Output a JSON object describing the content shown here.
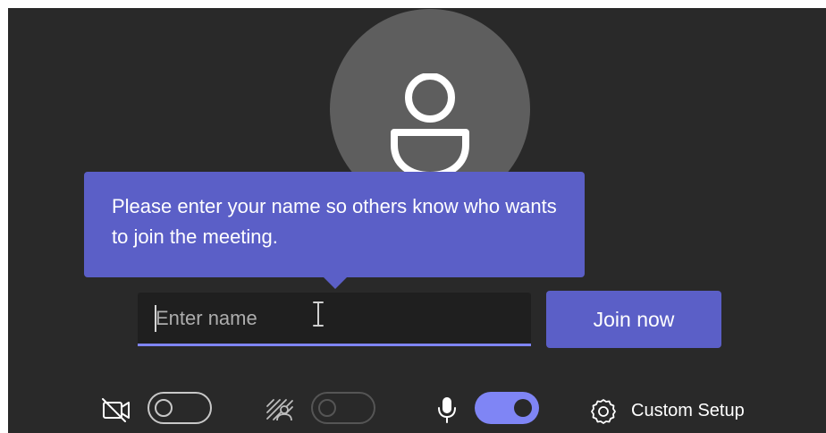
{
  "avatar": {
    "icon": "person-icon",
    "background": "#5e5e5e"
  },
  "tooltip": {
    "text": "Please enter your name so others know who wants to join the meeting.",
    "background": "#5b5fc7"
  },
  "name_input": {
    "value": "",
    "placeholder": "Enter name",
    "underline_color": "#7f85f5"
  },
  "join_button": {
    "label": "Join now",
    "background": "#5b5fc7"
  },
  "controls": {
    "camera": {
      "icon": "camera-off-icon",
      "state": "off"
    },
    "background_effects": {
      "icon": "background-effects-icon",
      "state": "disabled"
    },
    "microphone": {
      "icon": "microphone-icon",
      "state": "on"
    },
    "custom_setup": {
      "icon": "gear-icon",
      "label": "Custom Setup"
    }
  },
  "colors": {
    "stage_background": "#292929",
    "accent": "#7f85f5"
  }
}
